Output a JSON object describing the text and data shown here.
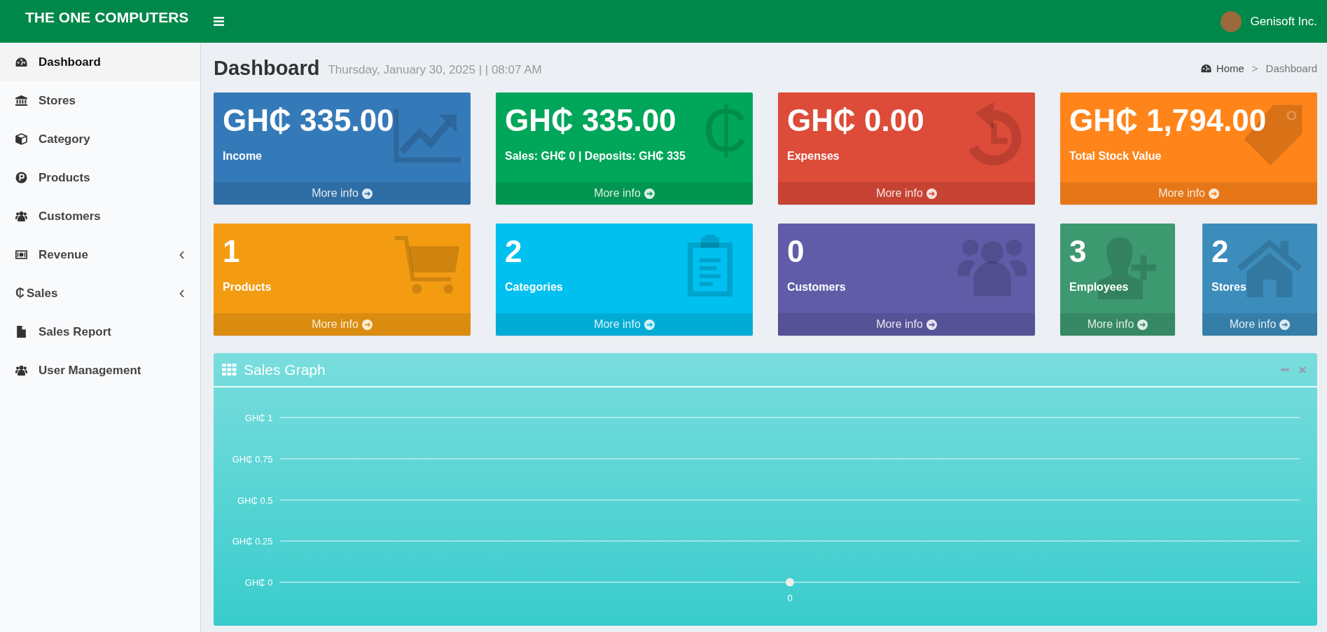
{
  "header": {
    "brand": "THE ONE COMPUTERS",
    "user_name": "Genisoft Inc."
  },
  "sidebar": {
    "items": [
      {
        "label": "Dashboard",
        "selected": true,
        "has_submenu": false
      },
      {
        "label": "Stores",
        "selected": false,
        "has_submenu": false
      },
      {
        "label": "Category",
        "selected": false,
        "has_submenu": false
      },
      {
        "label": "Products",
        "selected": false,
        "has_submenu": false
      },
      {
        "label": "Customers",
        "selected": false,
        "has_submenu": false
      },
      {
        "label": "Revenue",
        "selected": false,
        "has_submenu": true
      },
      {
        "label": "Sales",
        "glyph": "₵",
        "selected": false,
        "has_submenu": true
      },
      {
        "label": "Sales Report",
        "selected": false,
        "has_submenu": false
      },
      {
        "label": "User Management",
        "selected": false,
        "has_submenu": false
      }
    ]
  },
  "content_header": {
    "title": "Dashboard",
    "subtitle": "Thursday, January 30, 2025 | | 08:07 AM",
    "breadcrumb": {
      "items": [
        "Home",
        "Dashboard"
      ],
      "separator": ">"
    }
  },
  "stat_cards": [
    {
      "kind": "wide",
      "value": "GH₵ 335.00",
      "label": "Income",
      "color": "#357ab8",
      "link": "More info"
    },
    {
      "kind": "wide",
      "value": "GH₵ 335.00",
      "label": "Sales: GH₵ 0 | Deposits: GH₵ 335",
      "color": "#00a65a",
      "link": "More info",
      "glyph": "₵"
    },
    {
      "kind": "wide",
      "value": "GH₵ 0.00",
      "label": "Expenses",
      "color": "#dd4b39",
      "link": "More info"
    },
    {
      "kind": "wide",
      "value": "GH₵ 1,794.00",
      "label": "Total Stock Value",
      "color": "#ff851b",
      "link": "More info"
    },
    {
      "kind": "wide",
      "value": "1",
      "label": "Products",
      "color": "#f39c12",
      "link": "More info"
    },
    {
      "kind": "wide",
      "value": "2",
      "label": "Categories",
      "color": "#00c0ef",
      "link": "More info"
    },
    {
      "kind": "wide",
      "value": "0",
      "label": "Customers",
      "color": "#605ca8",
      "link": "More info"
    },
    {
      "kind": "small",
      "value": "3",
      "label": "Employees",
      "color": "#3d9970",
      "link": "More info"
    },
    {
      "kind": "small",
      "value": "2",
      "label": "Stores",
      "color": "#3c8dbc",
      "link": "More info"
    }
  ],
  "sales_graph": {
    "title": "Sales Graph",
    "chart_data": {
      "type": "line",
      "categories": [
        "0"
      ],
      "series": [
        {
          "color": "#eeeeee",
          "values": [
            0
          ],
          "marker": true
        }
      ],
      "grid": true,
      "ylim": [
        0,
        1
      ],
      "yticks": [
        {
          "value": 0,
          "label": "GH₵ 0"
        },
        {
          "value": 0.25,
          "label": "GH₵ 0.25"
        },
        {
          "value": 0.5,
          "label": "GH₵ 0.5"
        },
        {
          "value": 0.75,
          "label": "GH₵ 0.75"
        },
        {
          "value": 1,
          "label": "GH₵ 1"
        }
      ]
    }
  }
}
